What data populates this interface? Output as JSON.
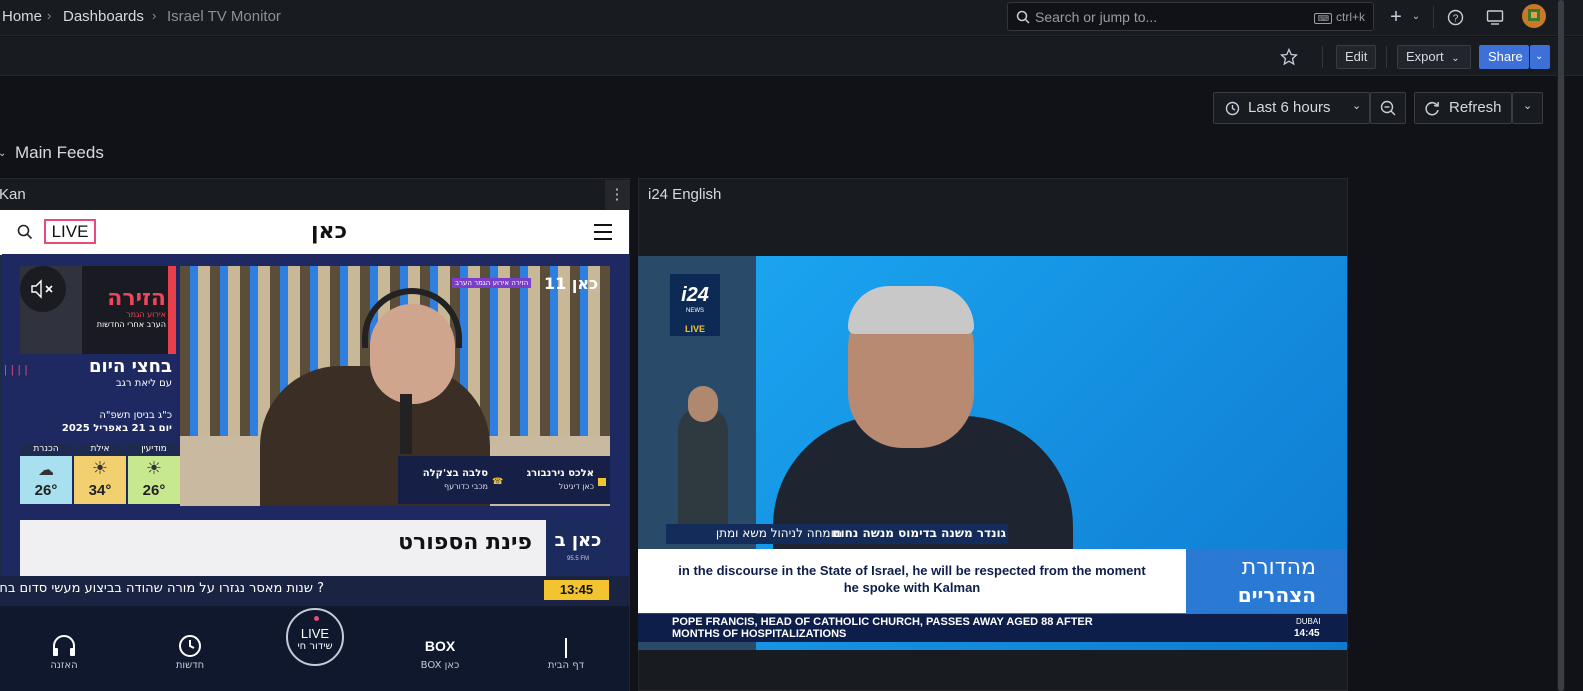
{
  "nav": {
    "breadcrumbs": [
      "Home",
      "Dashboards",
      "Israel TV Monitor"
    ],
    "search_placeholder": "Search or jump to...",
    "search_shortcut": "ctrl+k"
  },
  "toolbar": {
    "edit": "Edit",
    "export": "Export",
    "share": "Share"
  },
  "time": {
    "range": "Last 6 hours",
    "refresh": "Refresh"
  },
  "row": {
    "title": "Main Feeds"
  },
  "panels": {
    "kan": {
      "title": "Kan",
      "live_badge": "LIVE",
      "logo": "כאן",
      "show_title": "בחצי היום",
      "show_host": "עם ליאת רגב",
      "date_hebrew": "כ\"ג בניסן תשפ\"ה",
      "date_gregorian": "יום ב 21 באפריל 2025",
      "promo_title": "הזירה",
      "promo_sub": "אירוע הגמר",
      "promo_sub2": "הערב אחרי החדשות",
      "channel_tag": "כאן 11",
      "channel_promo": "הזירה אירוע הגמר הערב",
      "weather": [
        {
          "city": "מודיעין",
          "temp": "26°"
        },
        {
          "city": "אילת",
          "temp": "34°"
        },
        {
          "city": "הכנרת",
          "temp": "26°"
        }
      ],
      "caller1_name": "אלכס נירנבורג",
      "caller1_sub": "כאן דיגיטל",
      "caller2_name": "סלבה בצ'קלה",
      "caller2_sub": "מכבי כדורעף",
      "segment": "פינת הספורט",
      "station": "כאן ב",
      "station_freq": "95.5 FM",
      "ticker": "? שנות מאסר נגזרו על מורה שהודה בביצוע מעשי סדום בח",
      "clock": "13:45",
      "bottom_nav": [
        {
          "label": "האזנה",
          "icon": "headphones-icon"
        },
        {
          "label": "חדשות",
          "icon": "news-clock-icon"
        },
        {
          "label": "שידור חי",
          "icon": "live-icon",
          "top": "LIVE"
        },
        {
          "label": "כאן BOX",
          "icon": "box-icon",
          "top": "BOX"
        },
        {
          "label": "דף הבית",
          "icon": "home-bar-icon"
        }
      ]
    },
    "i24": {
      "title": "i24 English",
      "logo": "i24",
      "logo_sub": "NEWS",
      "live": "LIVE",
      "lower_third_name": "גונדר משנה בדימוס מנשה נחום",
      "lower_third_role": "מומחה לניהול משא ומתן",
      "subtitle_line1": "in the discourse in the State of Israel, he will be respected from the moment",
      "subtitle_line2": "he spoke with Kalman",
      "program": "מהדורת",
      "program2": "הצהריים",
      "ticker_line1": "POPE FRANCIS, HEAD OF CATHOLIC CHURCH, PASSES AWAY AGED 88 AFTER",
      "ticker_line2": "MONTHS OF HOSPITALIZATIONS",
      "city": "DUBAI",
      "clock": "14:45"
    }
  },
  "colors": {
    "accent": "#3d71d9",
    "kan_pink": "#e84a79",
    "i24_blue": "#1b8fe2",
    "clock_yellow": "#f4c430"
  }
}
